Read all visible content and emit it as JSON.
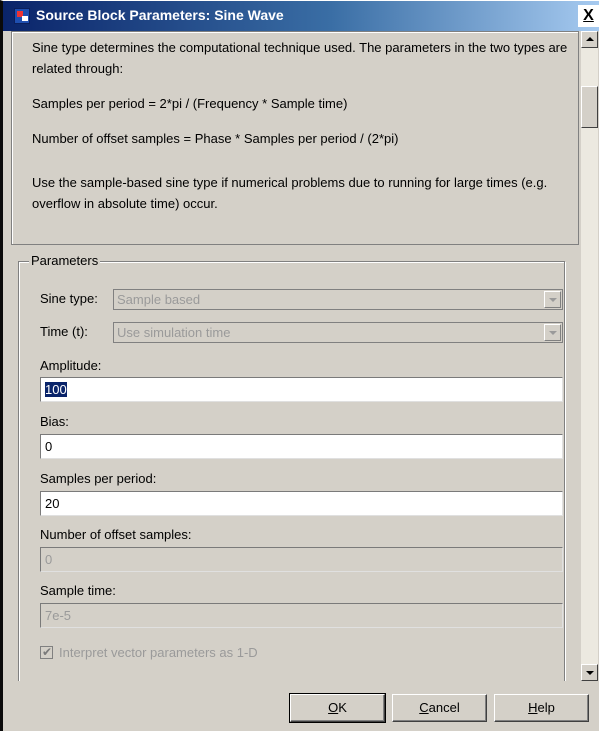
{
  "window": {
    "title": "Source Block Parameters: Sine Wave",
    "close_label": "X"
  },
  "description": [
    "Sine type determines the computational technique used. The parameters in the two types are related through:",
    "Samples per period = 2*pi / (Frequency * Sample time)",
    "Number of offset samples = Phase * Samples per period / (2*pi)",
    "Use the sample-based sine type if numerical problems due to running for large times (e.g. overflow in absolute time) occur."
  ],
  "parameters": {
    "legend": "Parameters",
    "sine_type": {
      "label": "Sine type:",
      "value": "Sample based"
    },
    "time": {
      "label": "Time (t):",
      "value": "Use simulation time"
    },
    "amplitude": {
      "label": "Amplitude:",
      "value": "100"
    },
    "bias": {
      "label": "Bias:",
      "value": "0"
    },
    "samples_per_period": {
      "label": "Samples per period:",
      "value": "20"
    },
    "offset_samples": {
      "label": "Number of offset samples:",
      "value": "0"
    },
    "sample_time": {
      "label": "Sample time:",
      "value": "7e-5"
    },
    "interpret_vector": {
      "label": "Interpret vector parameters as 1-D",
      "checked": true
    }
  },
  "buttons": {
    "ok": {
      "accel": "O",
      "rest": "K"
    },
    "cancel": {
      "accel": "C",
      "rest": "ancel"
    },
    "help": {
      "accel": "H",
      "rest": "elp"
    }
  }
}
